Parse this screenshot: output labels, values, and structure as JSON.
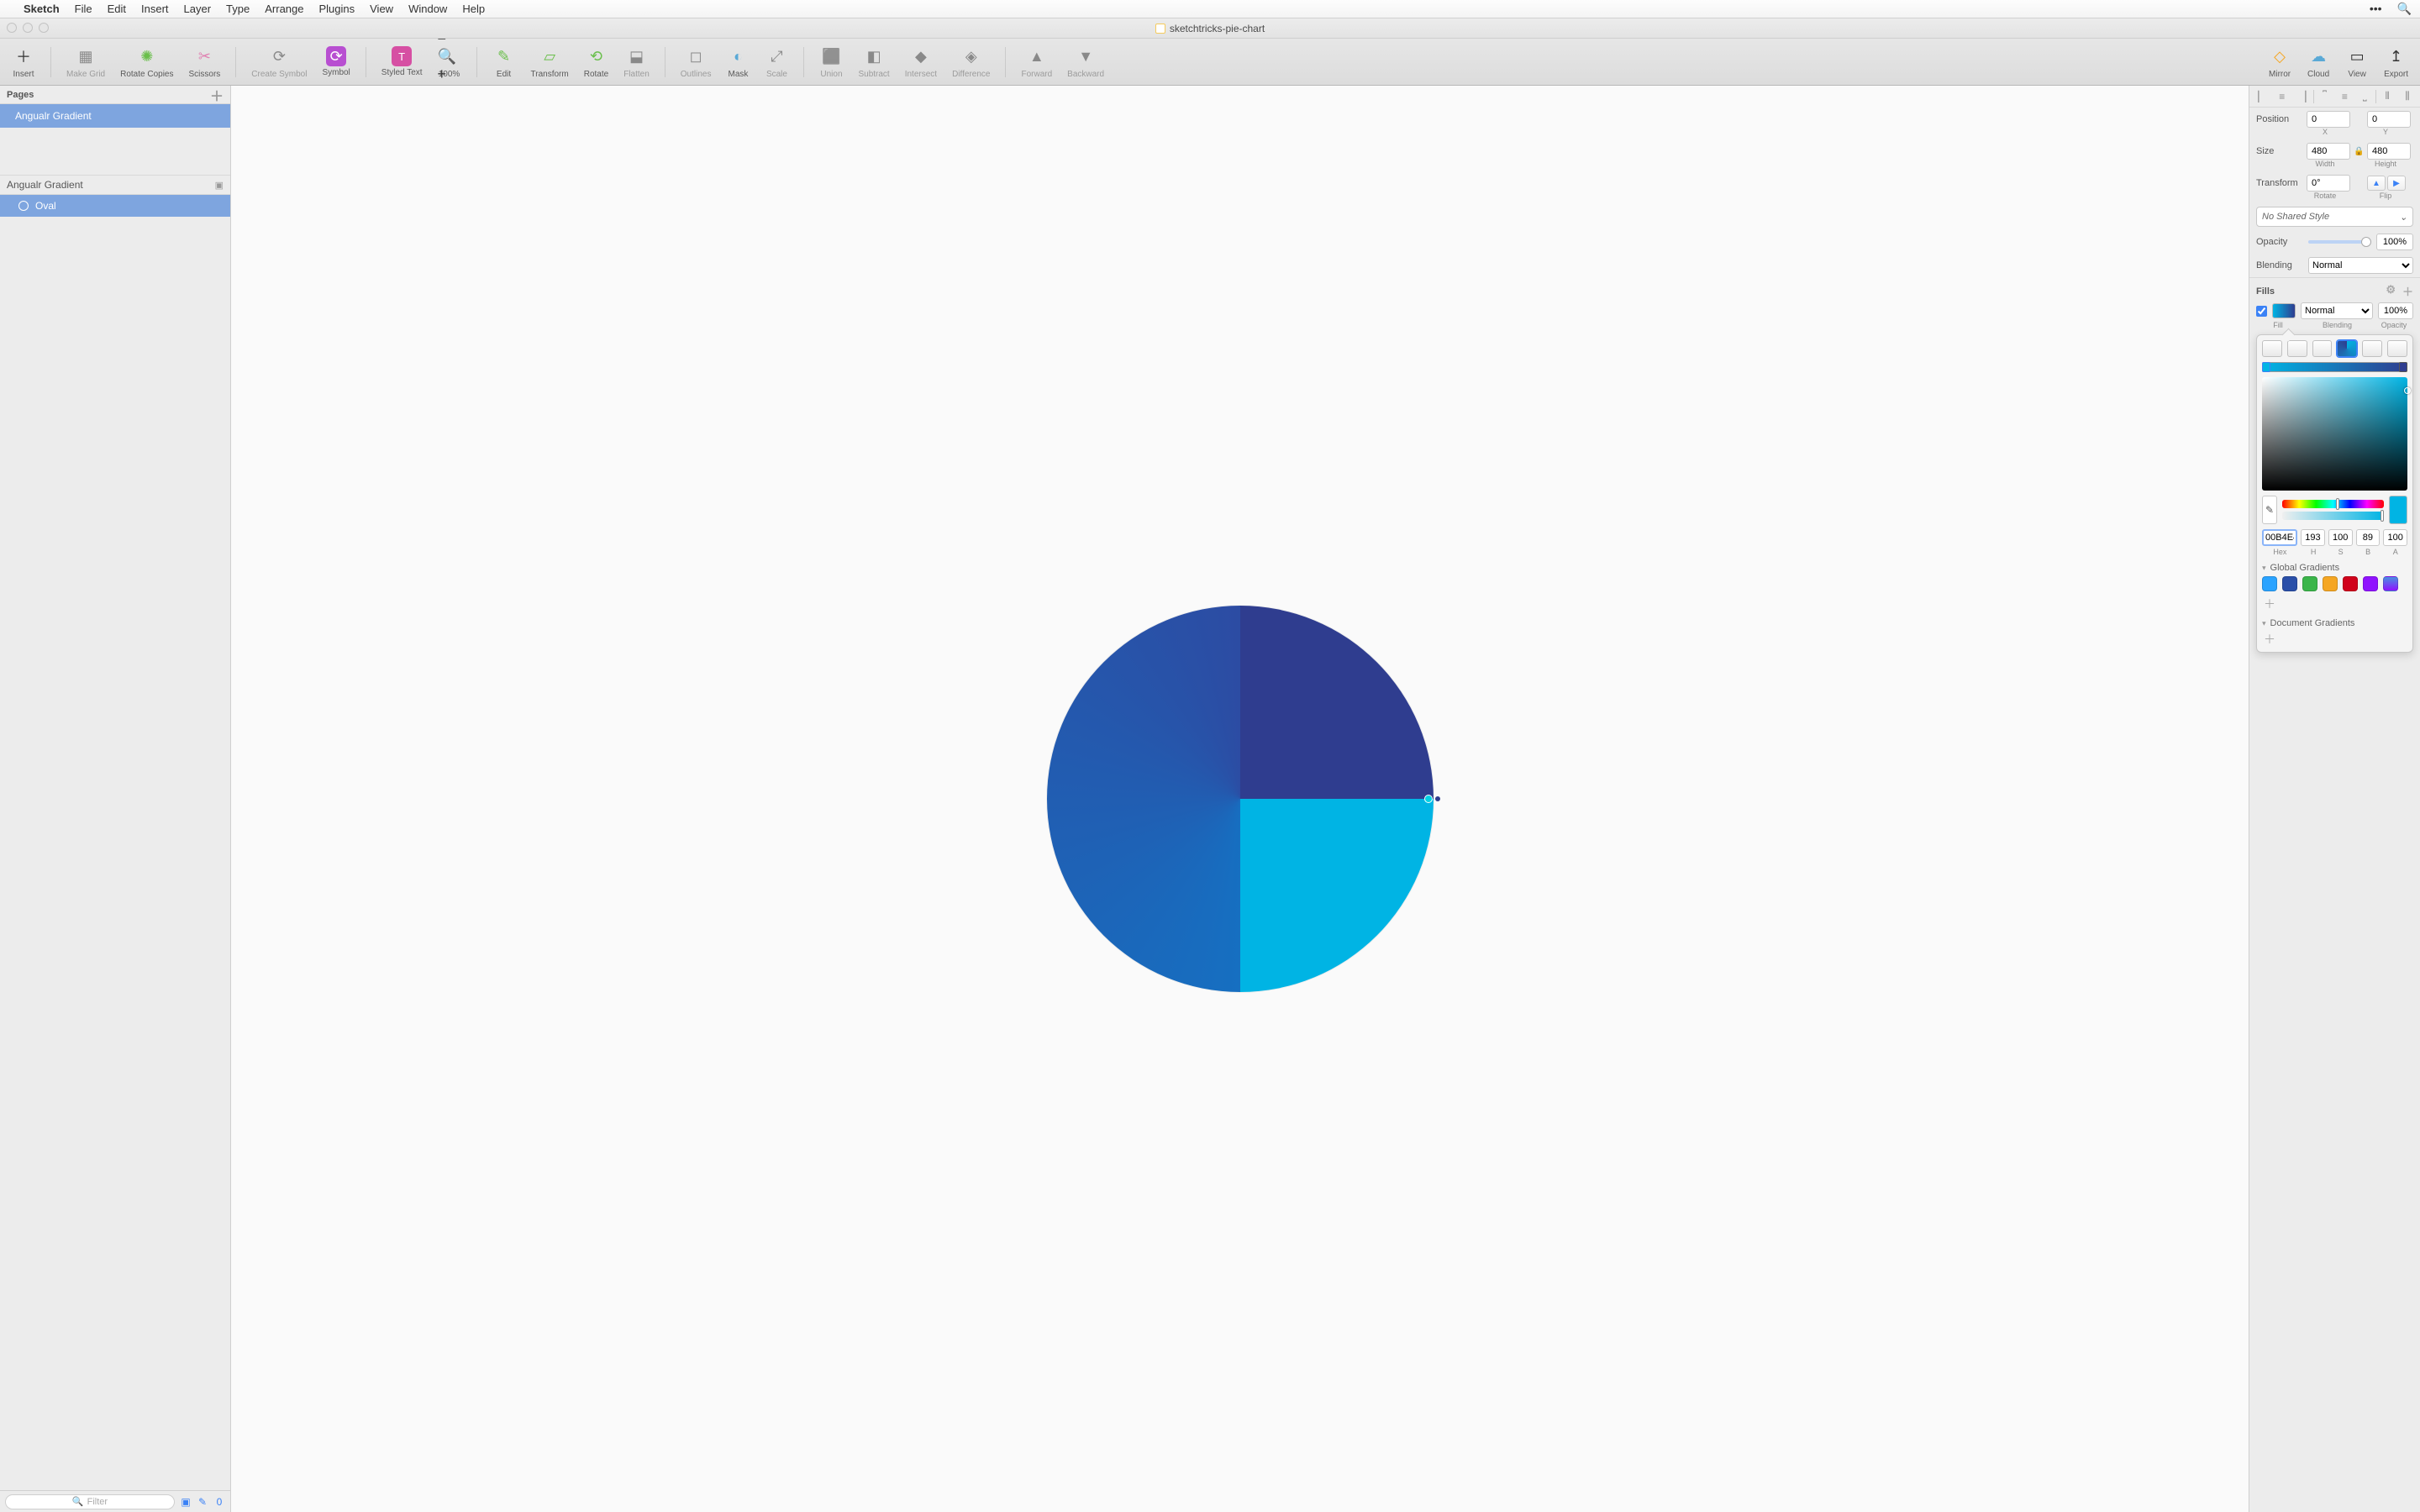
{
  "menubar": {
    "app": "Sketch",
    "items": [
      "File",
      "Edit",
      "Insert",
      "Layer",
      "Type",
      "Arrange",
      "Plugins",
      "View",
      "Window",
      "Help"
    ]
  },
  "titlebar": {
    "document": "sketchtricks-pie-chart"
  },
  "toolbar": {
    "insert": "Insert",
    "make_grid": "Make Grid",
    "rotate_copies": "Rotate Copies",
    "scissors": "Scissors",
    "create_symbol": "Create Symbol",
    "symbol": "Symbol",
    "styled_text": "Styled Text",
    "zoom": "100%",
    "edit": "Edit",
    "transform": "Transform",
    "rotate": "Rotate",
    "flatten": "Flatten",
    "outlines": "Outlines",
    "mask": "Mask",
    "scale": "Scale",
    "union": "Union",
    "subtract": "Subtract",
    "intersect": "Intersect",
    "difference": "Difference",
    "forward": "Forward",
    "backward": "Backward",
    "mirror": "Mirror",
    "cloud": "Cloud",
    "view": "View",
    "export": "Export"
  },
  "left": {
    "pages_label": "Pages",
    "page_selected": "Angualr Gradient",
    "artboard": "Angualr Gradient",
    "layer_selected": "Oval",
    "filter_placeholder": "Filter",
    "filter_count": "0"
  },
  "inspector": {
    "position_label": "Position",
    "x": "0",
    "y": "0",
    "x_lbl": "X",
    "y_lbl": "Y",
    "size_label": "Size",
    "width": "480",
    "height": "480",
    "w_lbl": "Width",
    "h_lbl": "Height",
    "transform_label": "Transform",
    "rotate": "0°",
    "rotate_lbl": "Rotate",
    "flip_lbl": "Flip",
    "shared_style": "No Shared Style",
    "opacity_label": "Opacity",
    "opacity": "100%",
    "blending_label": "Blending",
    "blending": "Normal",
    "fills_label": "Fills",
    "fill_blending": "Normal",
    "fill_opacity": "100%",
    "fill_sub_fill": "Fill",
    "fill_sub_blend": "Blending",
    "fill_sub_op": "Opacity",
    "color": {
      "hex": "00B4E4",
      "h": "193",
      "s": "100",
      "b": "89",
      "a": "100",
      "hex_lbl": "Hex",
      "h_lbl": "H",
      "s_lbl": "S",
      "b_lbl": "B",
      "a_lbl": "A",
      "global_label": "Global Gradients",
      "document_label": "Document Gradients",
      "global_swatches": [
        "#2aa3ff",
        "#2a4fa8",
        "#3bb54a",
        "#f5a623",
        "#d0021b",
        "#9013fe",
        "#4a90e2"
      ]
    }
  }
}
